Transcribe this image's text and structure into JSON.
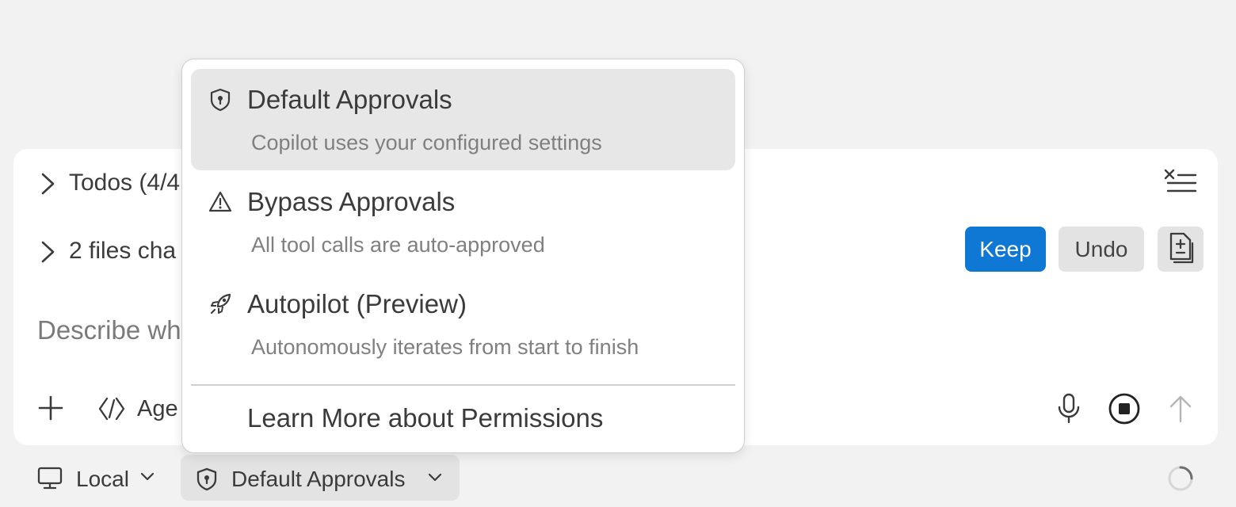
{
  "panel": {
    "todos_label": "Todos (4/4",
    "files_label": "2 files cha",
    "placeholder": "Describe wh",
    "keep_label": "Keep",
    "undo_label": "Undo",
    "agent_label": "Age"
  },
  "bottom_bar": {
    "local_label": "Local",
    "approvals_label": "Default Approvals"
  },
  "menu": {
    "items": [
      {
        "title": "Default Approvals",
        "description": "Copilot uses your configured settings",
        "icon": "shield-icon",
        "selected": true
      },
      {
        "title": "Bypass Approvals",
        "description": "All tool calls are auto-approved",
        "icon": "warning-icon",
        "selected": false
      },
      {
        "title": "Autopilot (Preview)",
        "description": "Autonomously iterates from start to finish",
        "icon": "rocket-icon",
        "selected": false
      }
    ],
    "learn_more": "Learn More about Permissions"
  },
  "colors": {
    "accent": "#0f78d4",
    "background": "#f2f2f2",
    "panel": "#ffffff"
  }
}
